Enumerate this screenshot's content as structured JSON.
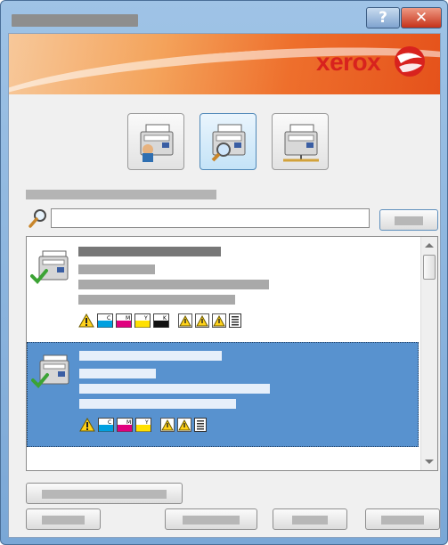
{
  "window": {
    "title": "",
    "help_glyph": "?",
    "close_glyph": "✕"
  },
  "banner": {
    "brand": "xerox"
  },
  "icons": {
    "search": "magnifier-icon",
    "status_ok": "green-check-icon",
    "warning": "warning-triangle-icon",
    "list": "list-icon"
  },
  "toners": [
    {
      "letter": "C",
      "color": "#00a0e0"
    },
    {
      "letter": "M",
      "color": "#e0007e"
    },
    {
      "letter": "Y",
      "color": "#ffe000"
    },
    {
      "letter": "K",
      "color": "#111111"
    }
  ],
  "printers": [
    {
      "lines": [
        "",
        "",
        "",
        ""
      ],
      "supplies": [
        "warn",
        "C",
        "M",
        "Y",
        "K",
        "warn-sm",
        "warn-sm",
        "warn-sm",
        "list"
      ]
    },
    {
      "lines": [
        "",
        "",
        "",
        ""
      ],
      "supplies": [
        "warn",
        "C",
        "M",
        "Y",
        "warn-sm",
        "warn-sm",
        "list"
      ]
    }
  ],
  "search": {
    "value": "",
    "placeholder": ""
  },
  "colors": {
    "selection": "#5892cf",
    "accent": "#ee6f2c",
    "brand_red": "#d8221e"
  }
}
